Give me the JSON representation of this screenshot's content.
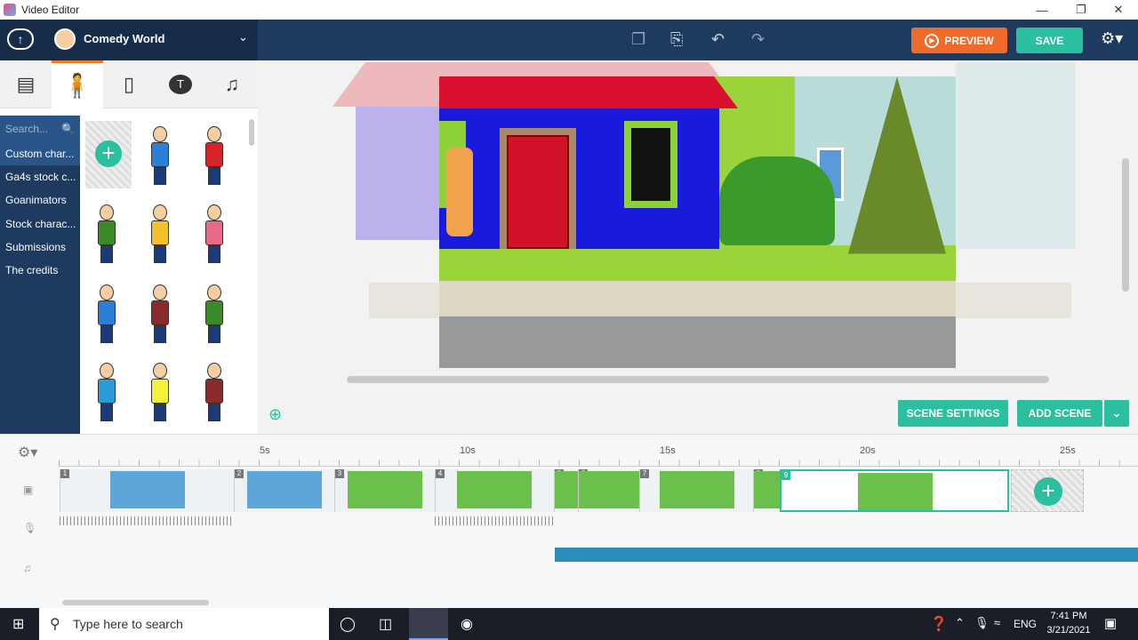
{
  "window": {
    "title": "Video Editor"
  },
  "header": {
    "project_name": "Comedy World",
    "preview_label": "PREVIEW",
    "save_label": "SAVE"
  },
  "left_panel": {
    "tabs": [
      "image-icon",
      "character-icon",
      "phone-icon",
      "speech-icon",
      "music-icon"
    ],
    "search_placeholder": "Search...",
    "categories": [
      "Custom char...",
      "Ga4s stock c...",
      "Goanimators",
      "Stock charac...",
      "Submissions",
      "The credits"
    ]
  },
  "stage": {
    "scene_settings_label": "SCENE SETTINGS",
    "add_scene_label": "ADD SCENE"
  },
  "timeline": {
    "ruler": [
      "5s",
      "10s",
      "15s",
      "20s",
      "25s"
    ],
    "scenes": [
      "1",
      "2",
      "3",
      "4",
      "5",
      "6",
      "7",
      "8",
      "9"
    ]
  },
  "taskbar": {
    "search_placeholder": "Type here to search",
    "language": "ENG",
    "time": "7:41 PM",
    "date": "3/21/2021"
  },
  "colors": {
    "accent_orange": "#f06a2a",
    "accent_green": "#2bbfa0",
    "header_navy": "#1e3a5f"
  }
}
